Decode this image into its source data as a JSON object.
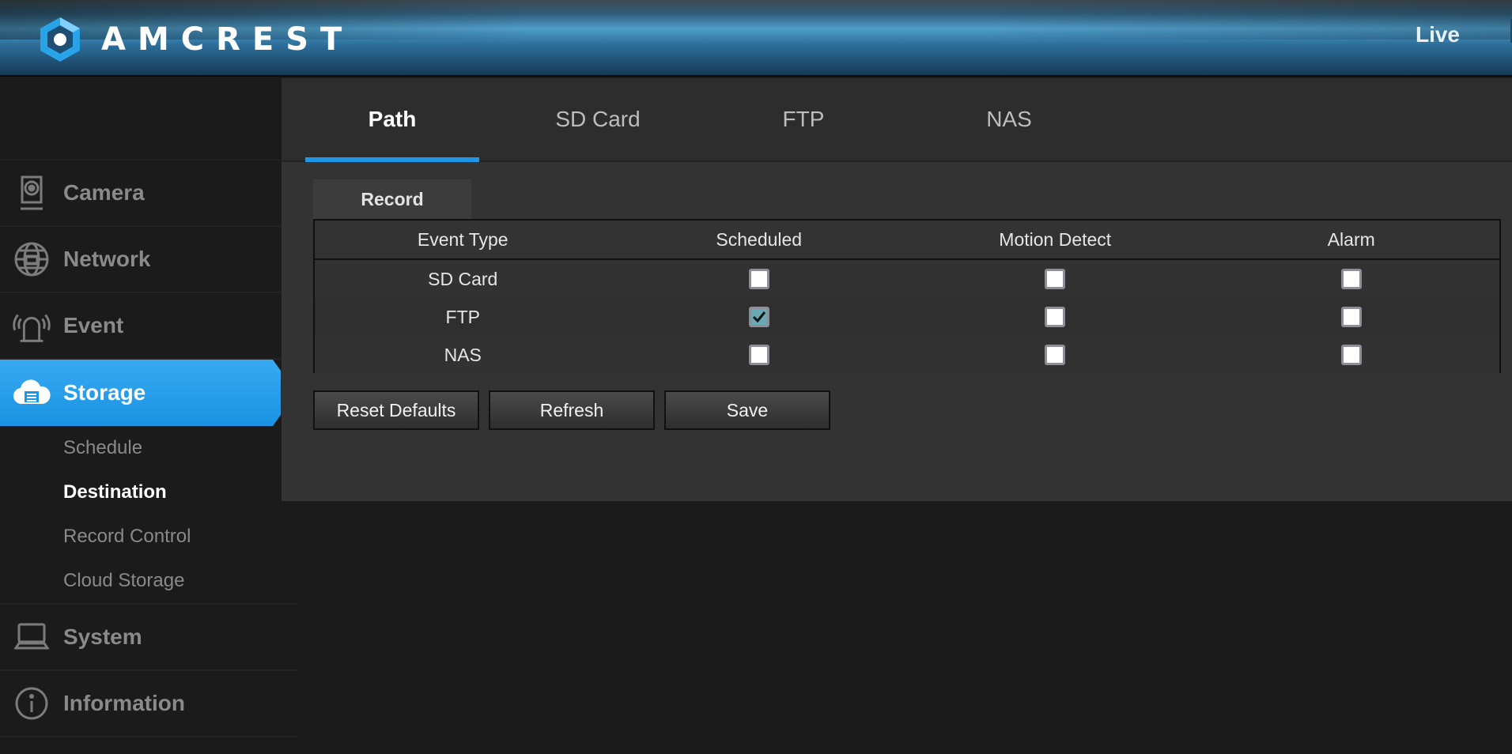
{
  "header": {
    "logo_text": "AMCREST",
    "live_label": "Live"
  },
  "sidebar": {
    "items": [
      {
        "label": "Camera",
        "icon": "camera-icon"
      },
      {
        "label": "Network",
        "icon": "network-globe-icon"
      },
      {
        "label": "Event",
        "icon": "alarm-siren-icon"
      },
      {
        "label": "Storage",
        "icon": "cloud-storage-icon",
        "active": true
      },
      {
        "label": "System",
        "icon": "computer-icon"
      },
      {
        "label": "Information",
        "icon": "info-icon"
      }
    ],
    "storage_submenu": [
      {
        "label": "Schedule"
      },
      {
        "label": "Destination",
        "current": true
      },
      {
        "label": "Record Control"
      },
      {
        "label": "Cloud Storage"
      }
    ]
  },
  "tabs": [
    {
      "label": "Path",
      "active": true
    },
    {
      "label": "SD Card"
    },
    {
      "label": "FTP"
    },
    {
      "label": "NAS"
    }
  ],
  "record_section": {
    "title": "Record",
    "columns": [
      "Event Type",
      "Scheduled",
      "Motion Detect",
      "Alarm"
    ],
    "rows": [
      {
        "type": "SD Card",
        "scheduled": false,
        "motion_detect": false,
        "alarm": false
      },
      {
        "type": "FTP",
        "scheduled": true,
        "motion_detect": false,
        "alarm": false
      },
      {
        "type": "NAS",
        "scheduled": false,
        "motion_detect": false,
        "alarm": false
      }
    ]
  },
  "buttons": {
    "reset_defaults": "Reset Defaults",
    "refresh": "Refresh",
    "save": "Save"
  },
  "colors": {
    "accent": "#1d96e6",
    "active_nav": "#1993e2",
    "checkbox_checked": "#6aa8b5"
  }
}
